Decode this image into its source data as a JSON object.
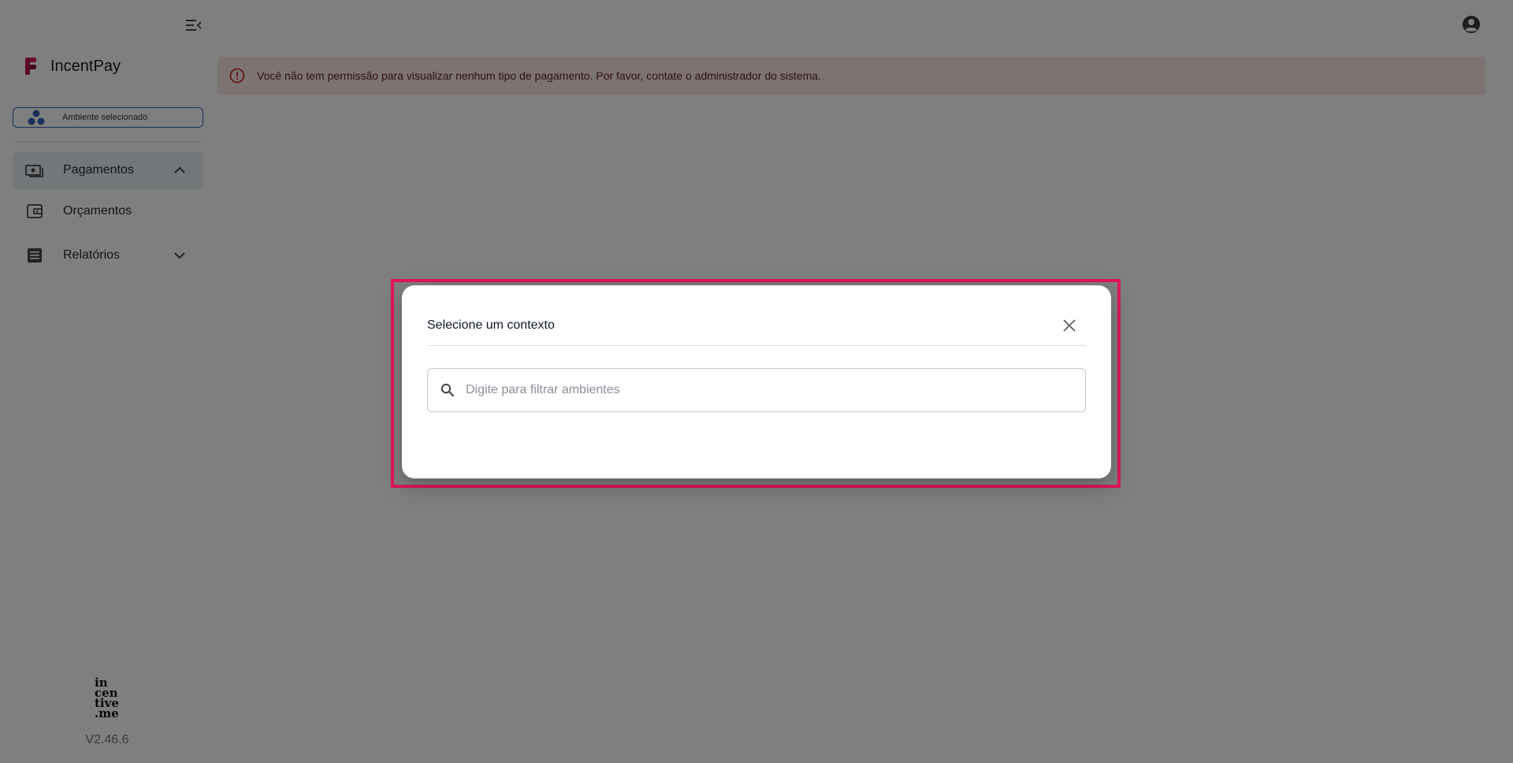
{
  "app": {
    "brand_name": "IncentPay",
    "version": "V2.46.6",
    "footer_logo_lines": [
      "in",
      "cen",
      "tive",
      ".me"
    ]
  },
  "sidebar": {
    "environment_label": "Ambiente selecionado",
    "items": [
      {
        "label": "Pagamentos",
        "icon": "payments-icon",
        "chevron": "chevron-up-icon",
        "active": true
      },
      {
        "label": "Orçamentos",
        "icon": "wallet-icon"
      },
      {
        "label": "Relatórios",
        "icon": "report-list-icon",
        "chevron": "chevron-down-icon"
      }
    ]
  },
  "alert": {
    "icon": "error-outline-icon",
    "message": "Você não tem permissão para visualizar nenhum tipo de pagamento. Por favor, contate o administrador do sistema."
  },
  "modal": {
    "title": "Selecione um contexto",
    "search_placeholder": "Digite para filtrar ambientes",
    "search_value": ""
  },
  "colors": {
    "brand": "#e0165b",
    "env_border": "#2f5fb3",
    "alert_bg": "#fbe7e6",
    "alert_icon": "#d32f2f",
    "highlight": "#e0165b"
  }
}
